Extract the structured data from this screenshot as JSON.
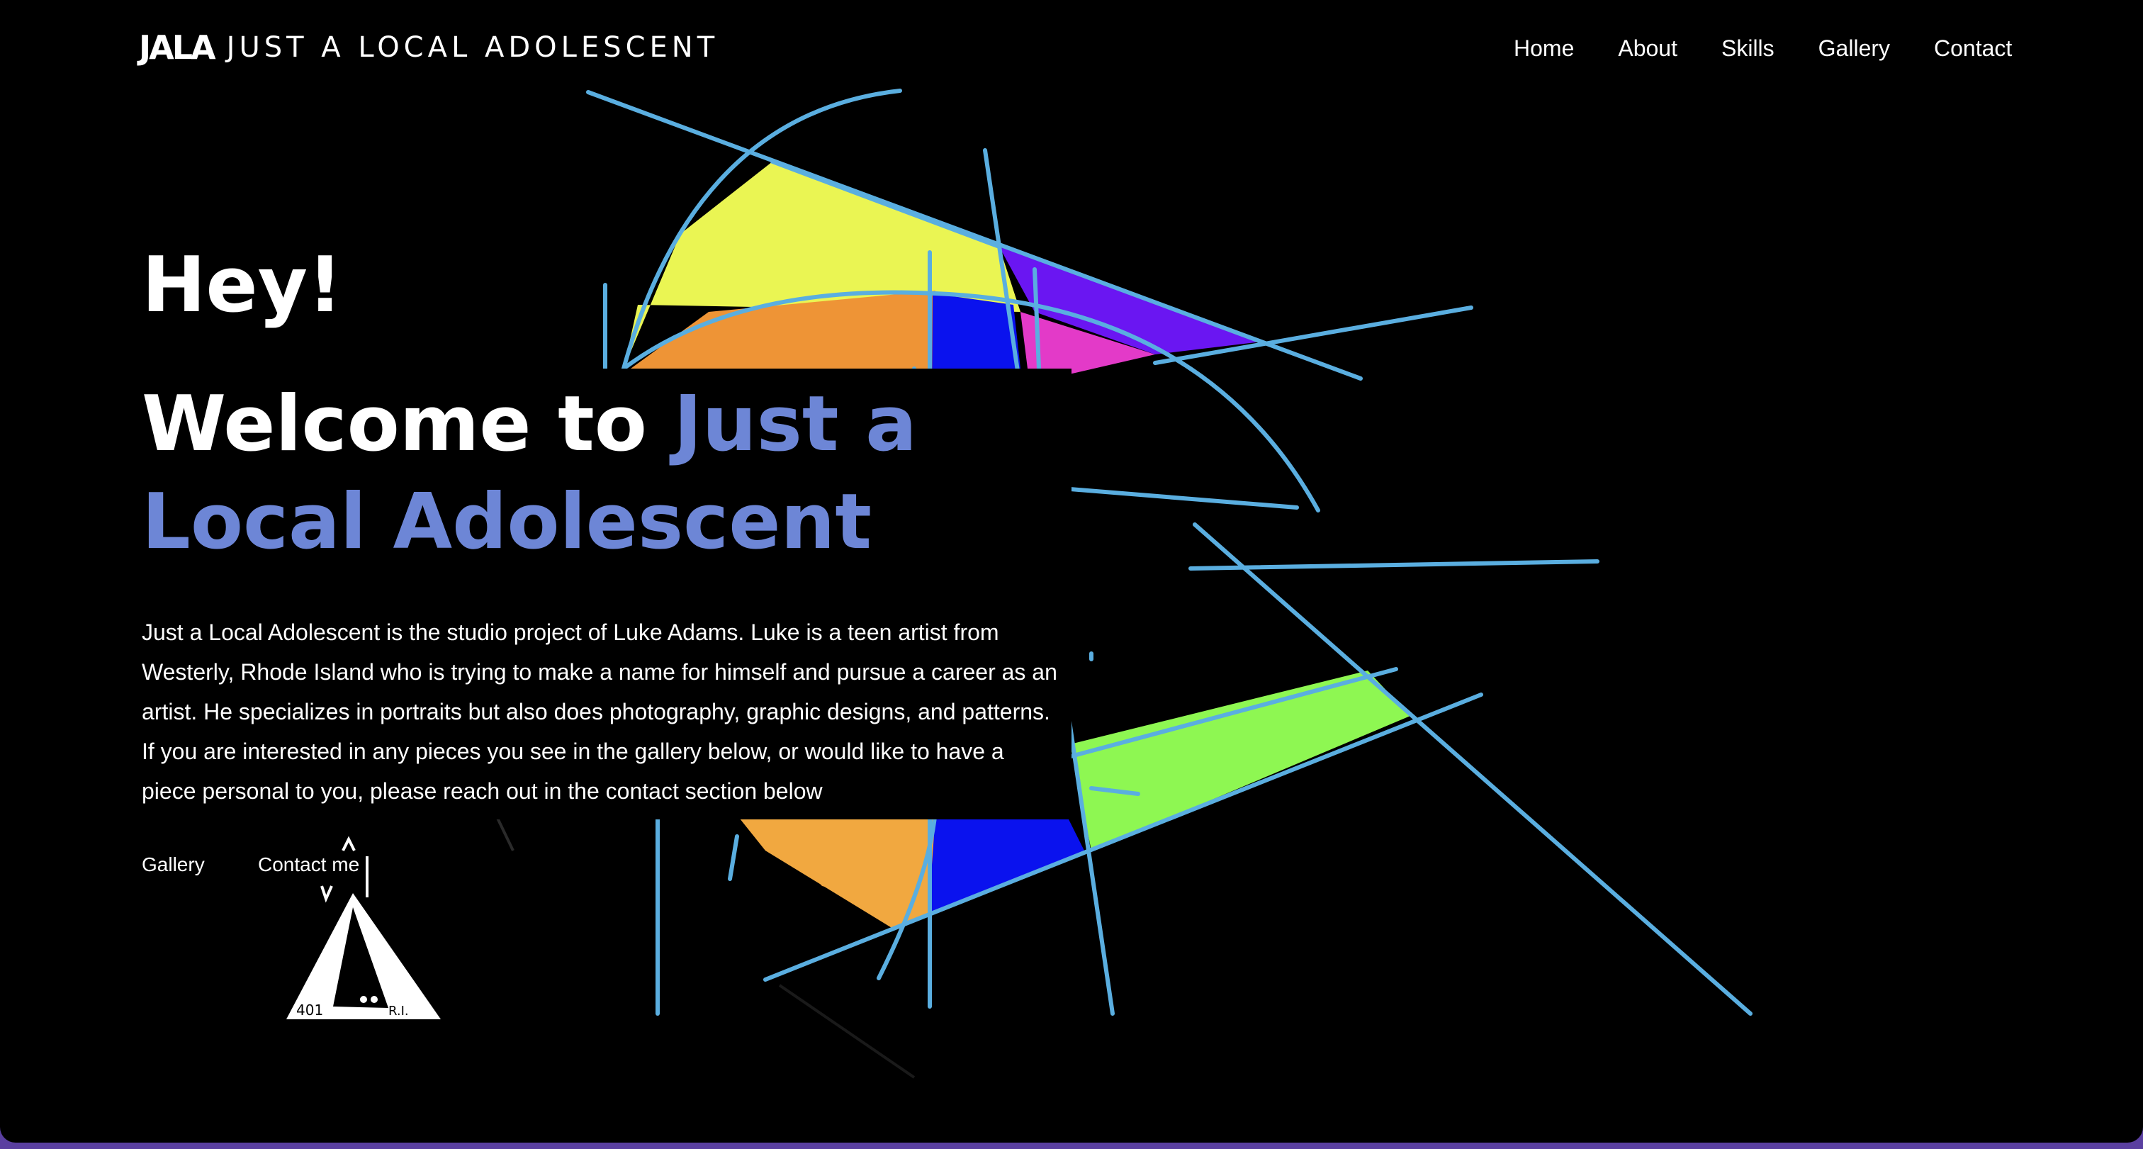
{
  "header": {
    "logo_mark": "JALA",
    "logo_text": "JUST A LOCAL ADOLESCENT"
  },
  "nav": [
    {
      "label": "Home"
    },
    {
      "label": "About"
    },
    {
      "label": "Skills"
    },
    {
      "label": "Gallery"
    },
    {
      "label": "Contact"
    }
  ],
  "hero": {
    "greeting": "Hey!",
    "welcome_prefix": "Welcome to ",
    "welcome_accent": "Just a Local Adolescent",
    "intro": "Just a Local Adolescent is the studio project of Luke Adams. Luke is a teen artist from Westerly, Rhode Island who is trying to make a name for himself and pursue a career as an artist. He specializes in portraits but also does photography, graphic designs, and patterns. If you are interested in any pieces you see in the gallery below, or would like to have a piece personal to you, please reach out in the contact section below",
    "gallery_button": "Gallery",
    "contact_button": "Contact me"
  },
  "badge": {
    "left_text": "401",
    "right_text": "R.I."
  },
  "colors": {
    "background": "#000000",
    "accent": "#6d86d6",
    "line": "#5aaee0",
    "window_frame": "#5a3fa0"
  }
}
